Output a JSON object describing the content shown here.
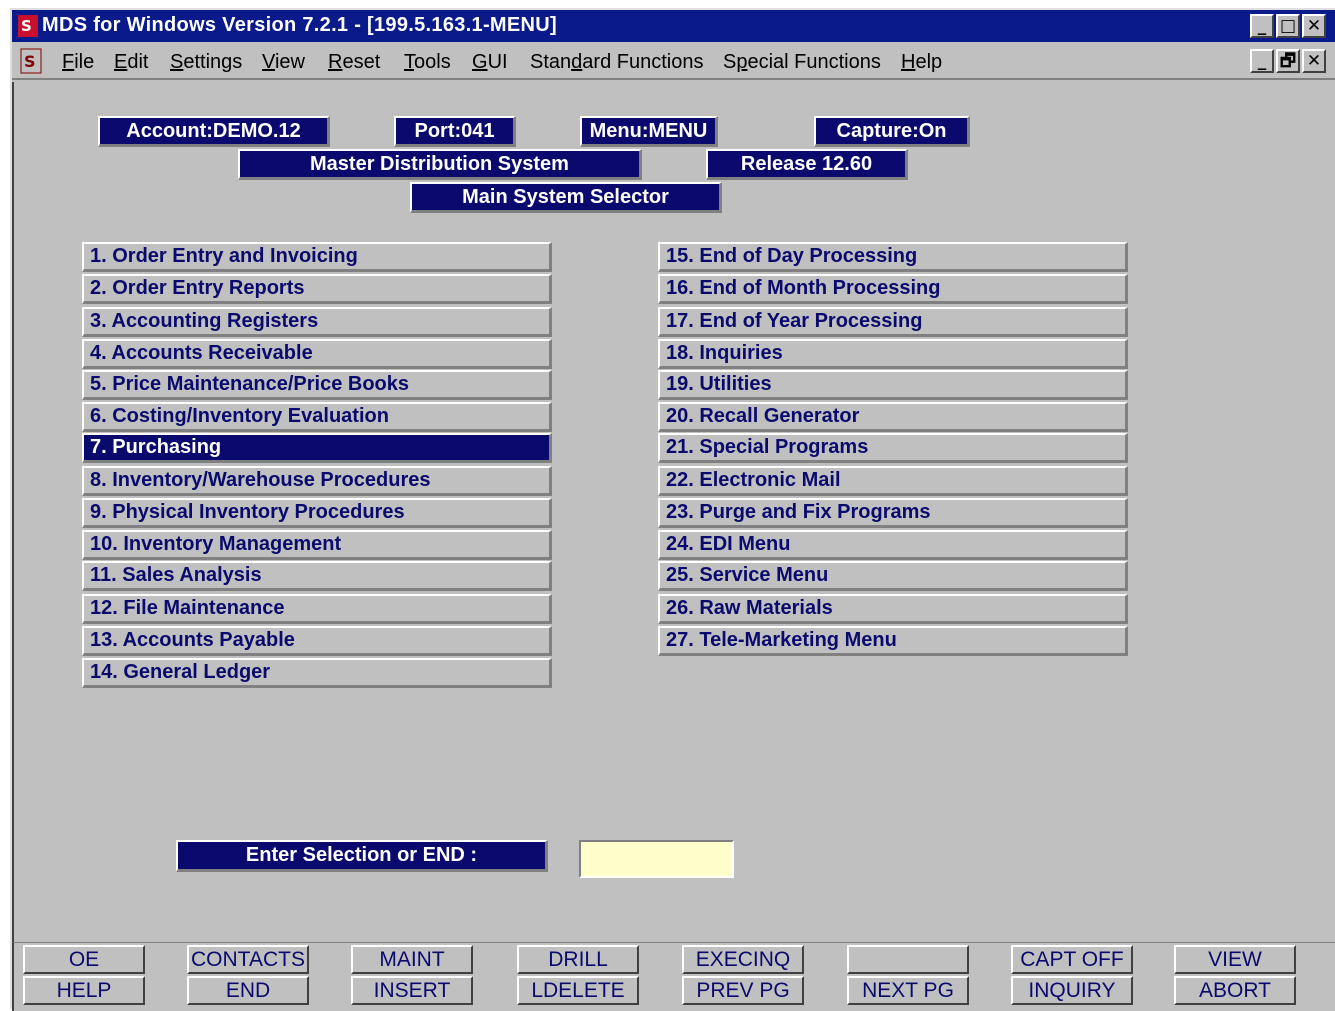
{
  "window": {
    "title": "MDS for Windows Version 7.2.1 - [199.5.163.1-MENU]",
    "title_buttons": [
      "_",
      "□",
      "✕"
    ],
    "mdi_buttons": [
      "_",
      "🗗",
      "✕"
    ]
  },
  "menubar": [
    {
      "pre": "",
      "u": "F",
      "post": "ile"
    },
    {
      "pre": "",
      "u": "E",
      "post": "dit"
    },
    {
      "pre": "",
      "u": "S",
      "post": "ettings"
    },
    {
      "pre": "",
      "u": "V",
      "post": "iew"
    },
    {
      "pre": "",
      "u": "R",
      "post": "eset"
    },
    {
      "pre": "",
      "u": "T",
      "post": "ools"
    },
    {
      "pre": "",
      "u": "G",
      "post": "UI"
    },
    {
      "pre": "Stan",
      "u": "d",
      "post": "ard Functions"
    },
    {
      "pre": "S",
      "u": "p",
      "post": "ecial Functions"
    },
    {
      "pre": "",
      "u": "H",
      "post": "elp"
    }
  ],
  "header": {
    "account": "Account:DEMO.12",
    "port": "Port:041",
    "menu": "Menu:MENU",
    "capture": "Capture:On",
    "system": "Master Distribution System",
    "release": "Release 12.60",
    "selector": "Main System Selector"
  },
  "menu_left": [
    "1. Order Entry and Invoicing",
    "2. Order Entry Reports",
    "3. Accounting Registers",
    "4. Accounts Receivable",
    "5. Price Maintenance/Price Books",
    "6. Costing/Inventory Evaluation",
    "7. Purchasing",
    "8. Inventory/Warehouse Procedures",
    "9. Physical Inventory Procedures",
    "10. Inventory Management",
    "11. Sales Analysis",
    "12. File Maintenance",
    "13. Accounts Payable",
    "14. General Ledger"
  ],
  "menu_right": [
    "15. End of Day Processing",
    "16. End of Month Processing",
    "17. End of Year Processing",
    "18. Inquiries",
    "19. Utilities",
    "20. Recall Generator",
    "21. Special Programs",
    "22. Electronic Mail",
    "23. Purge and Fix Programs",
    "24. EDI Menu",
    "25. Service Menu",
    "26. Raw Materials",
    "27. Tele-Marketing Menu"
  ],
  "selected_item": "7. Purchasing",
  "prompt": {
    "label": "Enter Selection or END :",
    "value": ""
  },
  "function_keys_top": [
    "OE",
    "CONTACTS",
    "MAINT",
    "DRILL",
    "EXECINQ",
    "",
    "CAPT OFF",
    "VIEW"
  ],
  "function_keys_bottom": [
    "HELP",
    "END",
    "INSERT",
    "LDELETE",
    "PREV PG",
    "NEXT PG",
    "INQUIRY",
    "ABORT"
  ],
  "colors": {
    "navy": "#0a0a6e",
    "titlebar": "#0a1a8a",
    "panel": "#c0c0c0",
    "input_bg": "#ffffcc"
  }
}
